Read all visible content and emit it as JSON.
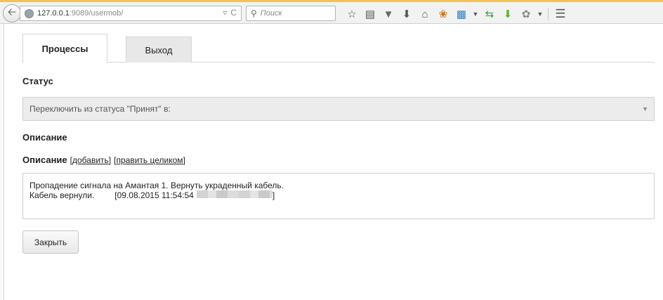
{
  "browser": {
    "url_host": "127.0.0.1",
    "url_rest": ":9089/usermob/",
    "url_actions": [
      "▿",
      "C"
    ],
    "search_placeholder": "Поиск"
  },
  "tabs": [
    {
      "label": "Процессы"
    },
    {
      "label": "Выход"
    }
  ],
  "status": {
    "label": "Статус",
    "select_value": "Переключить из статуса \"Принят\" в:"
  },
  "description": {
    "heading": "Описание",
    "field_label": "Описание",
    "add_link": "добавить",
    "edit_link": "править целиком",
    "line1": "Пропадение сигнала на Амантая 1. Вернуть украденный кабель.",
    "line2_text": "Кабель вернули.",
    "line2_stamp": "[09.08.2015 11:54:54",
    "line2_close": "]"
  },
  "actions": {
    "close_label": "Закрыть"
  }
}
